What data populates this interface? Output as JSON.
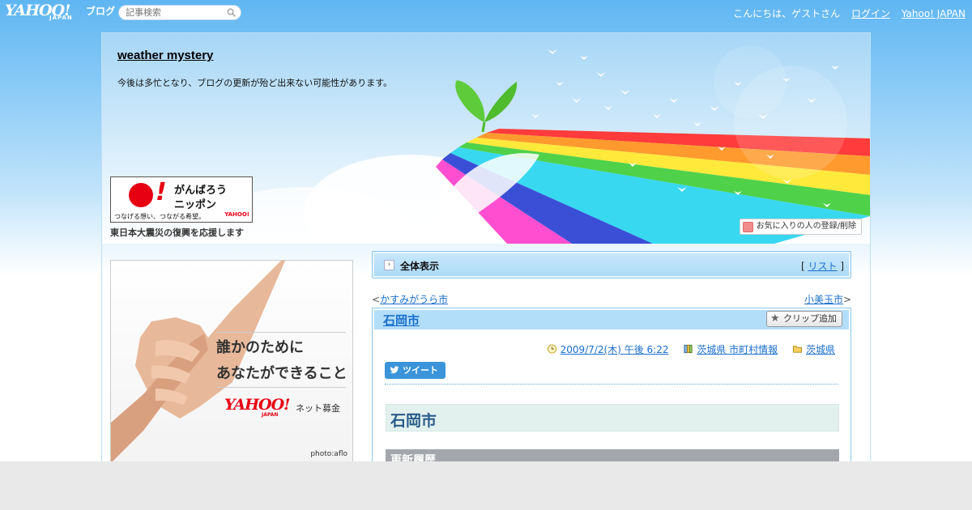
{
  "topbar": {
    "logo_yahoo": "YAHOO!",
    "logo_japan": "JAPAN",
    "logo_blog": "ブログ",
    "search_placeholder": "記事検索",
    "greeting": "こんにちは、ゲストさん",
    "login": "ログイン",
    "yahoo_japan": "Yahoo! JAPAN"
  },
  "header": {
    "title": "weather mystery",
    "description": "今後は多忙となり、ブログの更新が殆ど出来ない可能性があります。",
    "favorite_button": "お気に入りの人の登録/削除"
  },
  "ganbarou": {
    "line1": "がんばろう",
    "line2": "ニッポン",
    "tagline": "つなげる想い、つながる希望。",
    "brand": "YAHOO!",
    "caption": "東日本大震災の復興を応援します"
  },
  "ad": {
    "line1": "誰かのために",
    "line2": "あなたができること",
    "brand": "YAHOO!",
    "brand_sub": "JAPAN",
    "service": "ネット募金",
    "credit": "photo:aflo"
  },
  "allbar": {
    "label": "全体表示",
    "list_open": "[ ",
    "list_link": "リスト",
    "list_close": " ]"
  },
  "nav": {
    "prev_arrow": "<",
    "prev": "かすみがうら市",
    "next": "小美玉市",
    "next_arrow": ">"
  },
  "article": {
    "title": "石岡市",
    "clip_button": "クリップ追加",
    "date": "2009/7/2(木) 午後 6:22",
    "category": "茨城県 市町村情報",
    "folder": "茨城県",
    "tweet": "ツイート",
    "heading": "石岡市",
    "history": "更新履歴"
  },
  "colors": {
    "sky": "#5fb6f2",
    "link": "#1a6fcd",
    "bar": "#abdaf7",
    "tweet": "#3b94d9",
    "heading_bg": "#e3f1ee",
    "history_bg": "#a3a7ab"
  },
  "icons": [
    "search-icon",
    "heart-icon",
    "star-icon",
    "clock-icon",
    "book-icon",
    "folder-icon",
    "twitter-bird-icon",
    "chevron-right-icon"
  ]
}
